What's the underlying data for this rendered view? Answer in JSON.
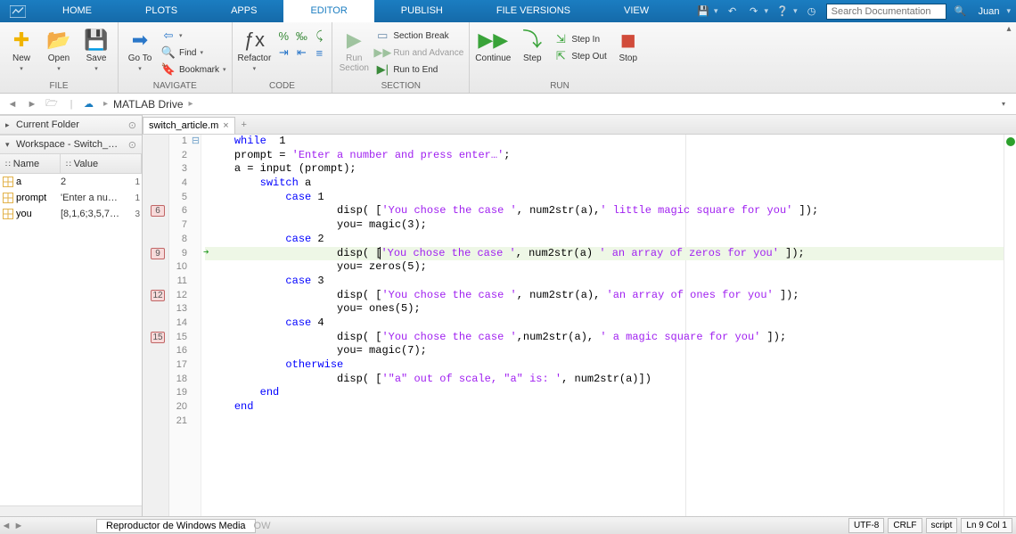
{
  "topMenu": {
    "items": [
      "HOME",
      "PLOTS",
      "APPS",
      "EDITOR",
      "PUBLISH",
      "FILE VERSIONS",
      "VIEW"
    ],
    "activeIndex": 3,
    "searchPlaceholder": "Search Documentation",
    "user": "Juan"
  },
  "ribbon": {
    "file": {
      "label": "FILE",
      "new": "New",
      "open": "Open",
      "save": "Save"
    },
    "navigate": {
      "label": "NAVIGATE",
      "goto": "Go To",
      "find": "Find",
      "bookmark": "Bookmark"
    },
    "code": {
      "label": "CODE",
      "refactor": "Refactor"
    },
    "section": {
      "label": "SECTION",
      "runSection": "Run\nSection",
      "sectionBreak": "Section Break",
      "runAdvance": "Run and Advance",
      "runToEnd": "Run to End"
    },
    "run": {
      "label": "RUN",
      "continue": "Continue",
      "step": "Step",
      "stepIn": "Step In",
      "stepOut": "Step Out",
      "stop": "Stop"
    }
  },
  "addressBar": {
    "crumb1": "MATLAB Drive"
  },
  "panels": {
    "currentFolderTitle": "Current Folder",
    "workspaceTitle": "Workspace - Switch_…",
    "wsHead": {
      "name": "Name",
      "value": "Value"
    },
    "wsVars": [
      {
        "name": "a",
        "value": "2",
        "right": "1"
      },
      {
        "name": "prompt",
        "value": "'Enter a nu…",
        "right": "1"
      },
      {
        "name": "you",
        "value": "[8,1,6;3,5,7…",
        "right": "3"
      }
    ]
  },
  "editorTab": {
    "file": "switch_article.m"
  },
  "code": [
    {
      "n": 1,
      "segs": [
        [
          " ",
          "kw",
          "while"
        ],
        [
          " ",
          "",
          "  1"
        ]
      ]
    },
    {
      "n": 2,
      "segs": [
        [
          "",
          "",
          "prompt = "
        ],
        [
          "",
          "str",
          "'Enter a number and press enter…'"
        ],
        [
          "",
          "",
          ";"
        ]
      ]
    },
    {
      "n": 3,
      "segs": [
        [
          "",
          "",
          "a = input (prompt);"
        ]
      ]
    },
    {
      "n": 4,
      "segs": [
        [
          "",
          "",
          "    "
        ],
        [
          "",
          "kw",
          "switch"
        ],
        [
          "",
          "",
          " a"
        ]
      ]
    },
    {
      "n": 5,
      "segs": [
        [
          "",
          "",
          "        "
        ],
        [
          "",
          "kw",
          "case"
        ],
        [
          "",
          "",
          " 1"
        ]
      ]
    },
    {
      "n": 6,
      "bp": true,
      "segs": [
        [
          "",
          "",
          "                disp( ["
        ],
        [
          "",
          "str",
          "'You chose the case '"
        ],
        [
          "",
          "",
          ", num2str(a),"
        ],
        [
          "",
          "str",
          "' little magic square for you'"
        ],
        [
          "",
          "",
          " ]);"
        ]
      ]
    },
    {
      "n": 7,
      "segs": [
        [
          "",
          "",
          "                you= magic(3);"
        ]
      ]
    },
    {
      "n": 8,
      "segs": [
        [
          "",
          "",
          "        "
        ],
        [
          "",
          "kw",
          "case"
        ],
        [
          "",
          "",
          " 2"
        ]
      ]
    },
    {
      "n": 9,
      "bp": true,
      "exec": true,
      "segs": [
        [
          "",
          "",
          "                disp( ["
        ],
        [
          "",
          "str",
          "'You chose the case '"
        ],
        [
          "",
          "",
          ", num2str(a) "
        ],
        [
          "",
          "str",
          "' an array of zeros for you'"
        ],
        [
          "",
          "",
          " ]);"
        ]
      ]
    },
    {
      "n": 10,
      "segs": [
        [
          "",
          "",
          "                you= zeros(5);"
        ]
      ]
    },
    {
      "n": 11,
      "segs": [
        [
          "",
          "",
          "        "
        ],
        [
          "",
          "kw",
          "case"
        ],
        [
          "",
          "",
          " 3"
        ]
      ]
    },
    {
      "n": 12,
      "bp": true,
      "segs": [
        [
          "",
          "",
          "                disp( ["
        ],
        [
          "",
          "str",
          "'You chose the case '"
        ],
        [
          "",
          "",
          ", num2str(a), "
        ],
        [
          "",
          "str",
          "'an array of ones for you'"
        ],
        [
          "",
          "",
          " ]);"
        ]
      ]
    },
    {
      "n": 13,
      "segs": [
        [
          "",
          "",
          "                you= ones(5);"
        ]
      ]
    },
    {
      "n": 14,
      "segs": [
        [
          "",
          "",
          "        "
        ],
        [
          "",
          "kw",
          "case"
        ],
        [
          "",
          "",
          " 4"
        ]
      ]
    },
    {
      "n": 15,
      "bp": true,
      "segs": [
        [
          "",
          "",
          "                disp( ["
        ],
        [
          "",
          "str",
          "'You chose the case '"
        ],
        [
          "",
          "",
          ",num2str(a), "
        ],
        [
          "",
          "str",
          "' a magic square for you'"
        ],
        [
          "",
          "",
          " ]);"
        ]
      ]
    },
    {
      "n": 16,
      "segs": [
        [
          "",
          "",
          "                you= magic(7);"
        ]
      ]
    },
    {
      "n": 17,
      "segs": [
        [
          "",
          "",
          "        "
        ],
        [
          "",
          "kw",
          "otherwise"
        ]
      ]
    },
    {
      "n": 18,
      "segs": [
        [
          "",
          "",
          "                disp( ["
        ],
        [
          "",
          "str",
          "'\"a\" out of scale, \"a\" is: '"
        ],
        [
          "",
          "",
          ", num2str(a)])"
        ]
      ]
    },
    {
      "n": 19,
      "segs": [
        [
          "",
          "",
          "    "
        ],
        [
          "",
          "kw",
          "end"
        ]
      ]
    },
    {
      "n": 20,
      "segs": [
        [
          "",
          "kw",
          "end"
        ]
      ]
    },
    {
      "n": 21,
      "segs": [
        [
          "",
          "",
          ""
        ]
      ]
    }
  ],
  "taskbar": {
    "btn": "Reproductor de Windows Media",
    "partial": "OW"
  },
  "status": {
    "enc": "UTF-8",
    "eol": "CRLF",
    "type": "script",
    "pos": "Ln 9  Col 1"
  }
}
